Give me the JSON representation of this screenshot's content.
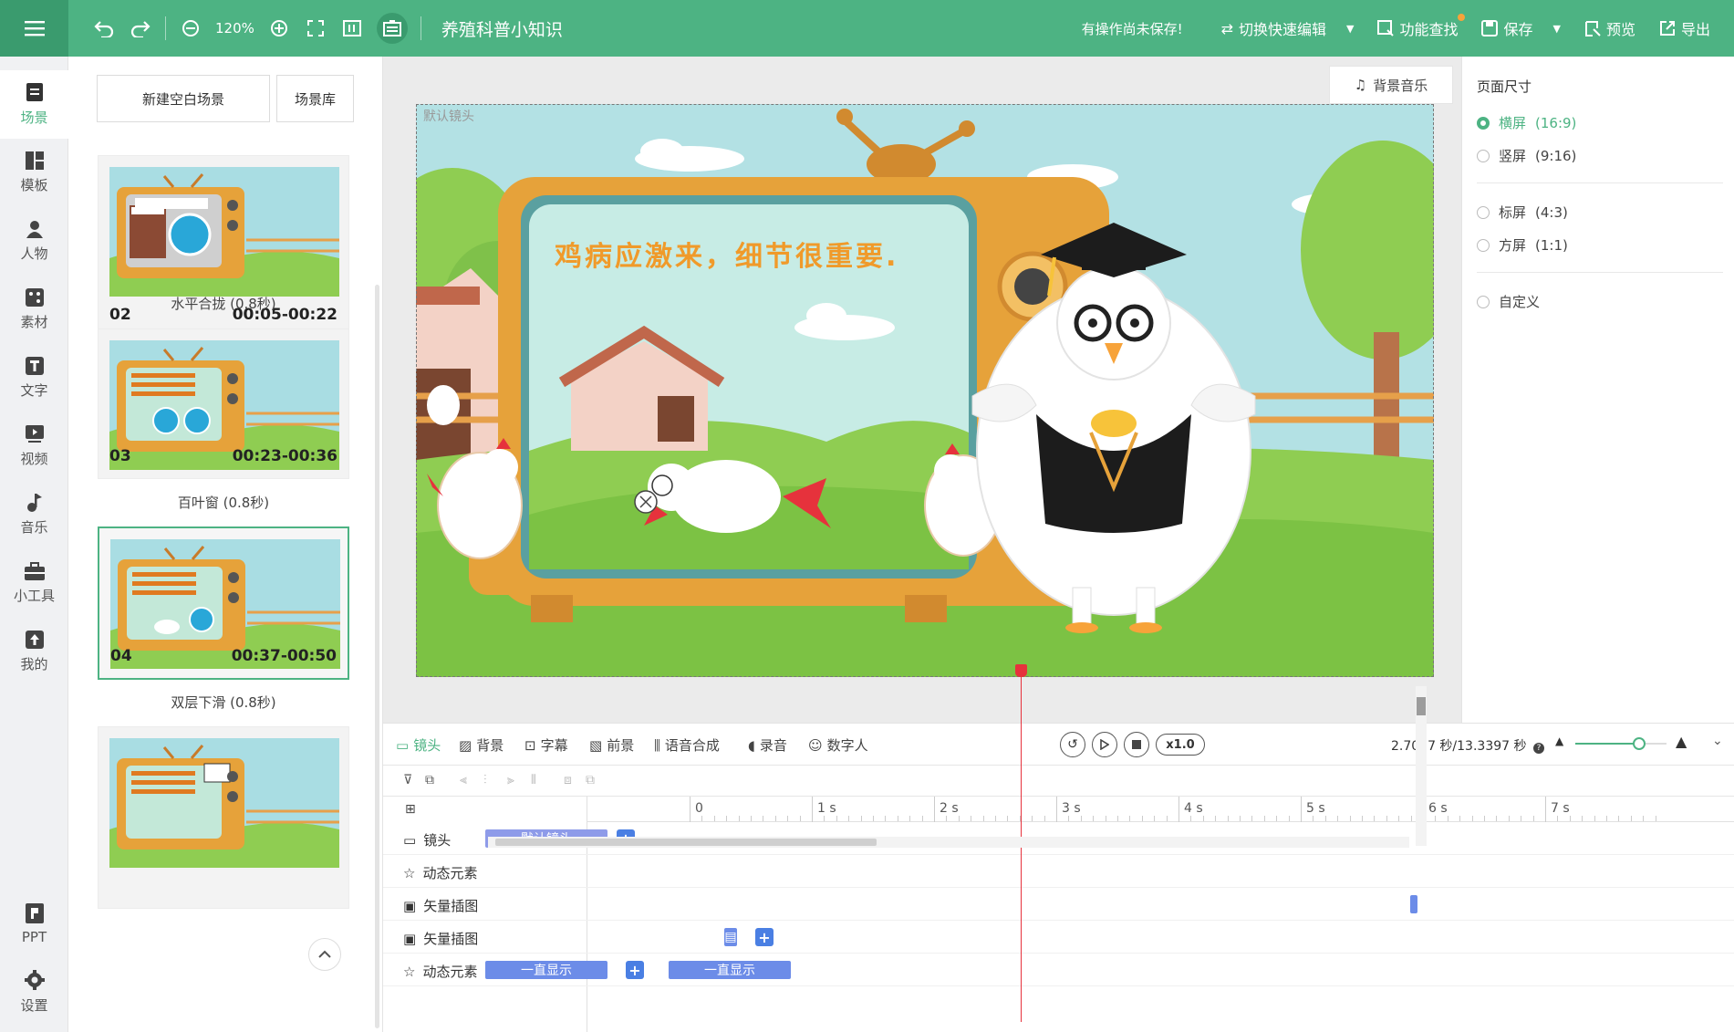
{
  "header": {
    "zoom": "120%",
    "title": "养殖科普小知识",
    "unsaved": "有操作尚未保存!",
    "switch_edit": "切换快速编辑",
    "find": "功能查找",
    "save": "保存",
    "preview": "预览",
    "export": "导出"
  },
  "nav": {
    "items": [
      {
        "label": "场景",
        "icon": "scene-icon"
      },
      {
        "label": "模板",
        "icon": "template-icon"
      },
      {
        "label": "人物",
        "icon": "person-icon"
      },
      {
        "label": "素材",
        "icon": "asset-icon"
      },
      {
        "label": "文字",
        "icon": "text-icon"
      },
      {
        "label": "视频",
        "icon": "video-icon"
      },
      {
        "label": "音乐",
        "icon": "music-icon"
      },
      {
        "label": "小工具",
        "icon": "toolbox-icon"
      },
      {
        "label": "我的",
        "icon": "upload-icon"
      }
    ],
    "ppt": "PPT",
    "settings": "设置"
  },
  "scenes": {
    "new_blank": "新建空白场景",
    "library": "场景库",
    "cards": [
      {
        "num": "02",
        "time": "00:05-00:22",
        "transition": "水平合拢 (0.8秒)"
      },
      {
        "num": "03",
        "time": "00:23-00:36",
        "transition": "百叶窗 (0.8秒)"
      },
      {
        "num": "04",
        "time": "00:37-00:50",
        "transition": "双层下滑 (0.8秒)"
      },
      {
        "num": "",
        "time": "",
        "transition": ""
      }
    ]
  },
  "canvas": {
    "bgm": "背景音乐",
    "stage_label": "默认镜头",
    "tv_text": "鸡病应激来，细节很重要."
  },
  "page_size": {
    "title": "页面尺寸",
    "options": [
      {
        "label": "横屏",
        "ratio": "(16:9)",
        "selected": true
      },
      {
        "label": "竖屏",
        "ratio": "(9:16)",
        "selected": false
      },
      {
        "label": "标屏",
        "ratio": "(4:3)",
        "selected": false
      },
      {
        "label": "方屏",
        "ratio": "(1:1)",
        "selected": false
      },
      {
        "label": "自定义",
        "ratio": "",
        "selected": false
      }
    ]
  },
  "timeline": {
    "tabs": [
      "镜头",
      "背景",
      "字幕",
      "前景",
      "语音合成",
      "录音",
      "数字人"
    ],
    "speed": "x1.0",
    "time": "2.7077 秒/13.3397 秒",
    "zoom_level": 0.7,
    "ruler": [
      "0",
      "1 s",
      "2 s",
      "3 s",
      "4 s",
      "5 s",
      "6 s",
      "7 s"
    ],
    "tracks": [
      {
        "name": "镜头",
        "icon": "camera-icon"
      },
      {
        "name": "动态元素",
        "icon": "star-icon"
      },
      {
        "name": "矢量插图",
        "icon": "image-icon"
      },
      {
        "name": "矢量插图",
        "icon": "image-icon"
      },
      {
        "name": "动态元素",
        "icon": "star-icon"
      }
    ],
    "clips": {
      "default_shot": "默认镜头",
      "always_show": "一直显示"
    },
    "playhead_seconds": 2.7077
  },
  "colors": {
    "brand": "#4db383",
    "clip": "#6c8ce8",
    "playhead": "#e6323c"
  }
}
